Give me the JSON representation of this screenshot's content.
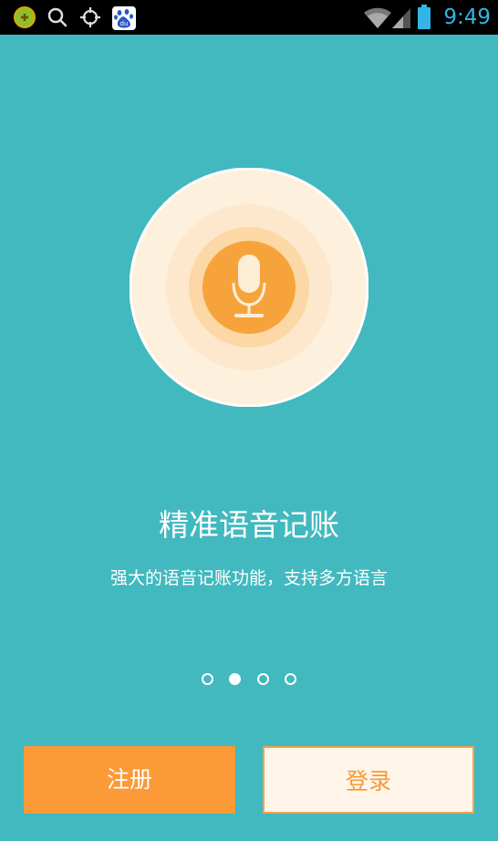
{
  "status_bar": {
    "time": "9:49",
    "left_icons": [
      "app-notification-icon",
      "search-icon",
      "gps-icon",
      "baidu-icon"
    ],
    "right_icons": [
      "wifi-icon",
      "cell-signal-icon",
      "battery-icon"
    ],
    "baidu_badge_text": "du"
  },
  "onboarding": {
    "title": "精准语音记账",
    "subtitle": "强大的语音记账功能，支持多方语言",
    "pages_total": 4,
    "current_page": 2,
    "illustration_icon": "microphone-icon"
  },
  "actions": {
    "register_label": "注册",
    "login_label": "登录"
  },
  "colors": {
    "background": "#41b9bf",
    "accent_orange": "#fb9a37",
    "login_background": "#fff5e8",
    "status_time": "#33b5e5"
  }
}
